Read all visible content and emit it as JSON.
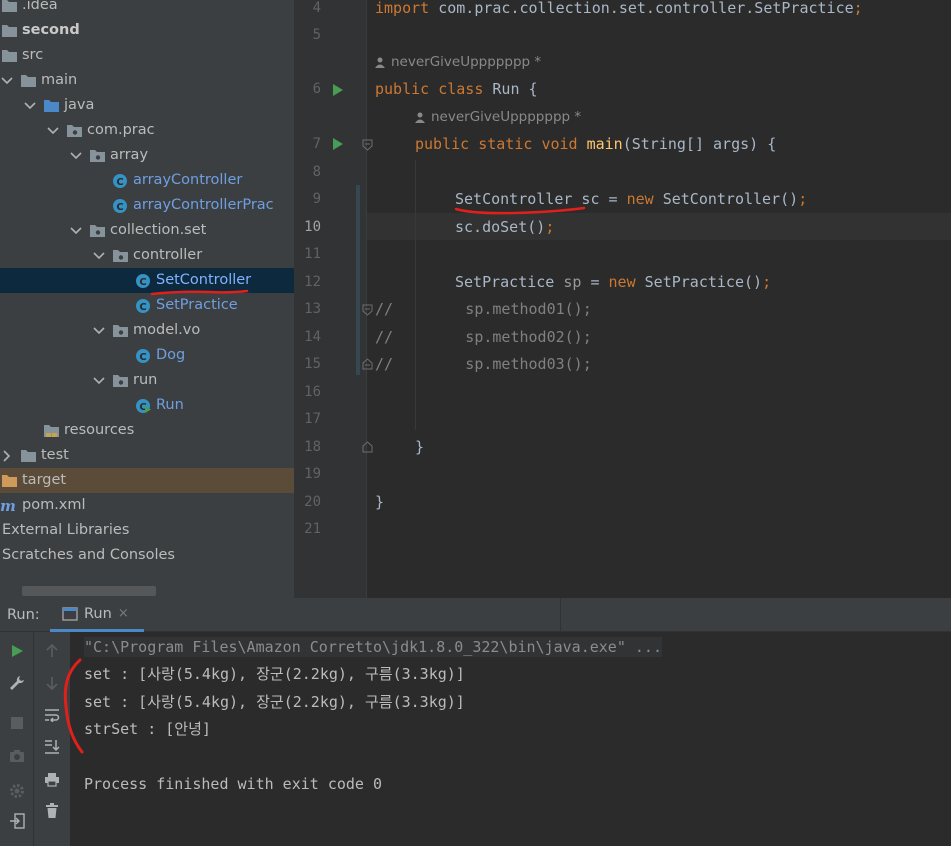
{
  "project_tree": [
    {
      "label": ".idea",
      "indent": 0,
      "icon": "folder-icon",
      "chevron": "none"
    },
    {
      "label": "second",
      "indent": 0,
      "icon": "folder-icon",
      "chevron": "none",
      "bold": true
    },
    {
      "label": "src",
      "indent": 0,
      "icon": "folder-icon",
      "chevron": "none"
    },
    {
      "label": "main",
      "indent": 1,
      "icon": "folder-icon",
      "chevron": "down"
    },
    {
      "label": "java",
      "indent": 2,
      "icon": "source-folder-icon",
      "chevron": "down"
    },
    {
      "label": "com.prac",
      "indent": 3,
      "icon": "package-icon",
      "chevron": "down"
    },
    {
      "label": "array",
      "indent": 4,
      "icon": "package-icon",
      "chevron": "down"
    },
    {
      "label": "arrayController",
      "indent": 5,
      "icon": "java-class-icon",
      "chevron": "none",
      "java": true
    },
    {
      "label": "arrayControllerPrac",
      "indent": 5,
      "icon": "java-class-icon",
      "chevron": "none",
      "java": true
    },
    {
      "label": "collection.set",
      "indent": 4,
      "icon": "package-icon",
      "chevron": "down"
    },
    {
      "label": "controller",
      "indent": 5,
      "icon": "package-icon",
      "chevron": "down"
    },
    {
      "label": "SetController",
      "indent": 6,
      "icon": "java-class-icon",
      "chevron": "none",
      "java": true,
      "selected": true
    },
    {
      "label": "SetPractice",
      "indent": 6,
      "icon": "java-class-icon",
      "chevron": "none",
      "java": true
    },
    {
      "label": "model.vo",
      "indent": 5,
      "icon": "package-icon",
      "chevron": "down"
    },
    {
      "label": "Dog",
      "indent": 6,
      "icon": "java-class-icon",
      "chevron": "none",
      "java": true
    },
    {
      "label": "run",
      "indent": 5,
      "icon": "package-icon",
      "chevron": "down"
    },
    {
      "label": "Run",
      "indent": 6,
      "icon": "java-main-class-icon",
      "chevron": "none",
      "java": true
    },
    {
      "label": "resources",
      "indent": 2,
      "icon": "resources-folder-icon",
      "chevron": "none"
    },
    {
      "label": "test",
      "indent": 1,
      "icon": "folder-icon",
      "chevron": "right"
    },
    {
      "label": "target",
      "indent": 0,
      "icon": "excluded-folder-icon",
      "chevron": "none",
      "highlight": true
    },
    {
      "label": "pom.xml",
      "indent": 0,
      "icon": "maven-icon",
      "chevron": "none"
    },
    {
      "label": "External Libraries",
      "indent": 0,
      "icon": "none",
      "chevron": "none"
    },
    {
      "label": "Scratches and Consoles",
      "indent": 0,
      "icon": "none",
      "chevron": "none"
    }
  ],
  "editor": {
    "line_numbers": [
      "4",
      "5",
      "6",
      "7",
      "8",
      "9",
      "10",
      "11",
      "12",
      "13",
      "14",
      "15",
      "16",
      "17",
      "18",
      "19",
      "20",
      "21"
    ],
    "current_line": "10",
    "author_hint": "neverGiveUppppppp *",
    "code": {
      "l4_kw": "import",
      "l4_rest": " com.prac.collection.set.controller.SetPractice",
      "semicolon": ";",
      "l6_kw1": "public",
      "l6_kw2": "class",
      "l6_name": "Run {",
      "l7_kw1": "public",
      "l7_kw2": "static",
      "l7_kw3": "void",
      "l7_fn": "main",
      "l7_rest": "(String[] args) {",
      "l9_type": "SetController",
      "l9_mid": " sc = ",
      "l9_new": "new",
      "l9_end": " SetController()",
      "l10_text": "sc.doSet()",
      "l12_type": "SetPractice",
      "l12_var": " sp",
      "l12_mid": " = ",
      "l12_new": "new",
      "l12_end": " SetPractice()",
      "l13": "//        sp.method01();",
      "l14": "//        sp.method02();",
      "l15": "//        sp.method03();",
      "l18": "}",
      "l20": "}"
    }
  },
  "run_panel": {
    "title": "Run:",
    "tab_label": "Run",
    "tab_close": "×",
    "console_lines": [
      "\"C:\\Program Files\\Amazon Corretto\\jdk1.8.0_322\\bin\\java.exe\" ...",
      "set : [사랑(5.4kg), 장군(2.2kg), 구름(3.3kg)]",
      "set : [사랑(5.4kg), 장군(2.2kg), 구름(3.3kg)]",
      "strSet : [안녕]",
      "",
      "Process finished with exit code 0"
    ]
  },
  "colors": {
    "keyword": "#cc7832",
    "function": "#ffc66d",
    "java_class": "#6f9fe0",
    "selection": "#0d293e",
    "annotation_red": "#e0201b",
    "run_green": "#499c54"
  }
}
